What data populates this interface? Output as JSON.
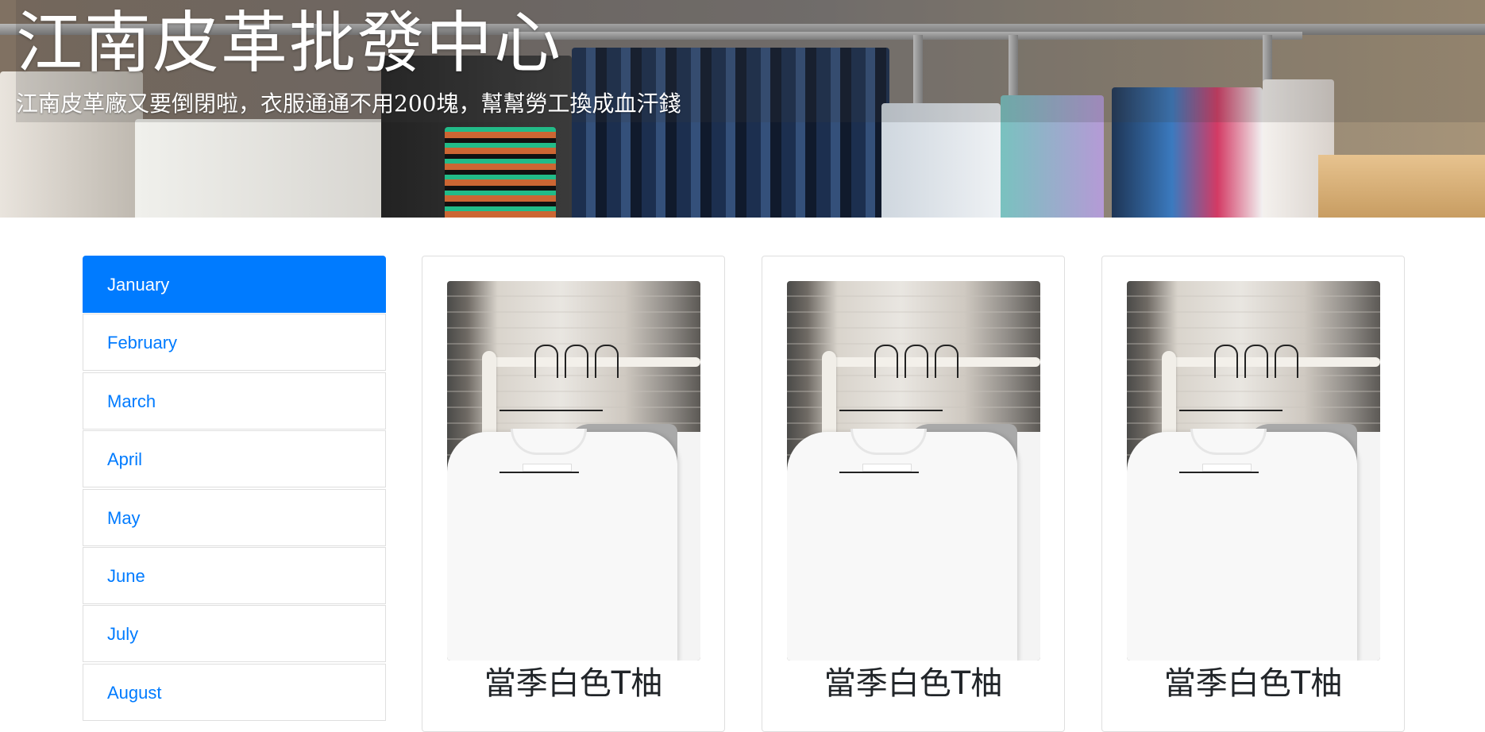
{
  "header": {
    "title": "江南皮革批發中心",
    "subtitle": "江南皮革廠又要倒閉啦，衣服通通不用200塊，幫幫勞工換成血汗錢"
  },
  "sidebar": {
    "items": [
      {
        "label": "January",
        "active": true
      },
      {
        "label": "February",
        "active": false
      },
      {
        "label": "March",
        "active": false
      },
      {
        "label": "April",
        "active": false
      },
      {
        "label": "May",
        "active": false
      },
      {
        "label": "June",
        "active": false
      },
      {
        "label": "July",
        "active": false
      },
      {
        "label": "August",
        "active": false
      }
    ]
  },
  "products": [
    {
      "title": "當季白色T柚"
    },
    {
      "title": "當季白色T柚"
    },
    {
      "title": "當季白色T柚"
    }
  ],
  "colors": {
    "accent": "#007bff",
    "text": "#212529",
    "border": "rgba(0,0,0,0.125)"
  }
}
